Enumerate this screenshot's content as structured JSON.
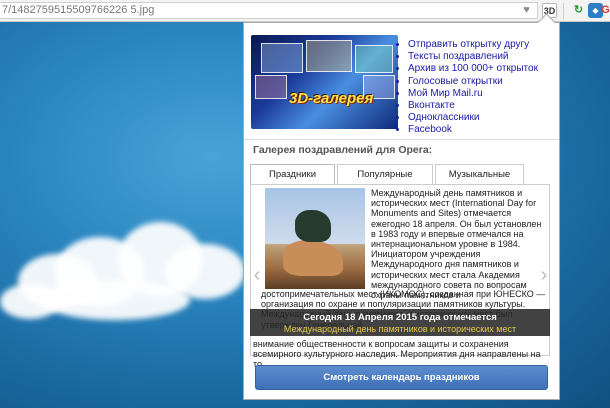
{
  "browser": {
    "url": "7/1482759515509766226 5.jpg",
    "ext_label": "3D"
  },
  "popup": {
    "banner_title": "3D-галерея",
    "links": [
      "Отправить открытку другу",
      "Тексты поздравлений",
      "Архив из 100 000+ открыток",
      "Голосовые открытки",
      "Мой Мир Mail.ru",
      "Вконтакте",
      "Одноклассники",
      "Facebook"
    ],
    "gallery_title": "Галерея поздравлений для Opera:",
    "tabs": [
      "Праздники сегодня",
      "Популярные открытки",
      "Музыкальные треки"
    ],
    "article": {
      "text_right": "Международный день памятников и исторических мест (International Day for Monuments and Sites) отмечается ежегодно 18 апреля. Он был установлен в 1983 году и впервые отмечался на интернациональном уровне в 1984. Инициатором учреждения Международного дня памятников и исторических мест стала Академия международного совета по вопросам охраны памятников и",
      "text_full": "достопримечательных мест (ИКОМОС), созданная при ЮНЕСКО — организация по охране и популяризации памятников культуры. Международный день памятников и исторических мест был утвержден Генеральной",
      "footer": "внимание общественности к вопросам защиты и сохранения всемирного культурного наследия. Мероприятия дня направлены на то,"
    },
    "caption": {
      "title": "Сегодня 18 Апреля 2015 года отмечается",
      "subtitle": "Международный день памятников и исторических мест"
    },
    "calendar_button": "Смотреть календарь праздников"
  }
}
